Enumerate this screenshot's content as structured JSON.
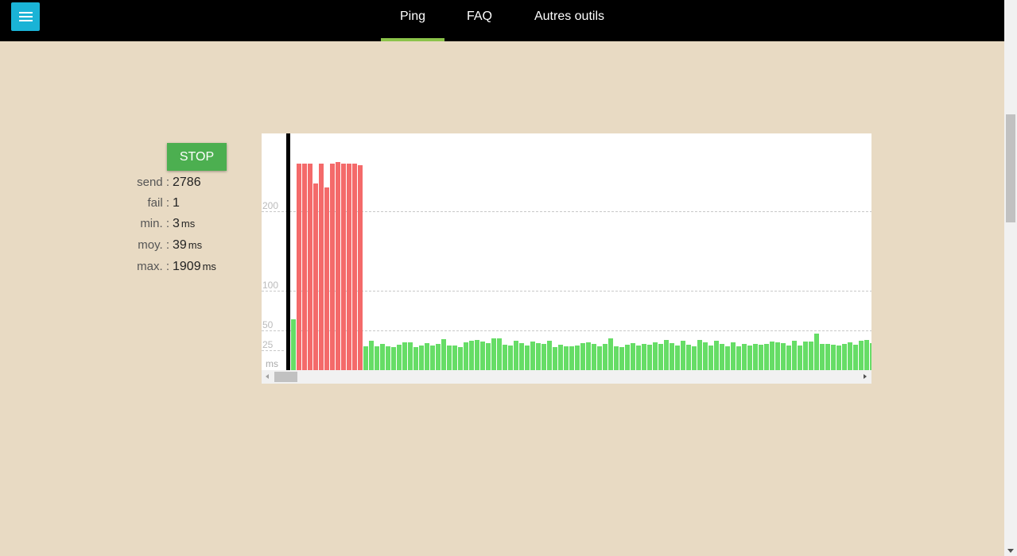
{
  "nav": {
    "tabs": [
      {
        "label": "Ping",
        "active": true
      },
      {
        "label": "FAQ",
        "active": false
      },
      {
        "label": "Autres outils",
        "active": false
      }
    ],
    "menu_icon": "hamburger-menu-icon"
  },
  "controls": {
    "stop_label": "STOP"
  },
  "stats": [
    {
      "label": "send :",
      "value": "2786",
      "unit": ""
    },
    {
      "label": "fail :",
      "value": "1",
      "unit": ""
    },
    {
      "label": "min. :",
      "value": "3",
      "unit": "ms"
    },
    {
      "label": "moy. :",
      "value": "39",
      "unit": "ms"
    },
    {
      "label": "max. :",
      "value": "1909",
      "unit": "ms"
    }
  ],
  "colors": {
    "ok": "#66dd66",
    "slow": "#f46a6a",
    "accent": "#8bc34a",
    "stop": "#4caf50",
    "menu": "#1ab3d6"
  },
  "chart_data": {
    "type": "bar",
    "ylabel": "ms",
    "y_ticks": [
      "200",
      "100",
      "50",
      "25"
    ],
    "ylim": [
      0,
      300
    ],
    "threshold_ms": 100,
    "values": [
      64,
      260,
      260,
      260,
      235,
      260,
      230,
      260,
      262,
      260,
      260,
      260,
      258,
      30,
      37,
      30,
      33,
      30,
      29,
      32,
      35,
      35,
      29,
      31,
      34,
      31,
      33,
      39,
      31,
      31,
      29,
      35,
      37,
      38,
      36,
      34,
      40,
      40,
      32,
      31,
      37,
      34,
      31,
      36,
      34,
      33,
      37,
      29,
      32,
      30,
      30,
      31,
      34,
      35,
      33,
      30,
      33,
      40,
      30,
      29,
      32,
      34,
      31,
      33,
      32,
      35,
      33,
      38,
      34,
      31,
      37,
      32,
      30,
      38,
      35,
      31,
      37,
      33,
      30,
      35,
      30,
      33,
      31,
      33,
      32,
      33,
      36,
      35,
      34,
      31,
      37,
      31,
      36,
      36,
      46,
      33,
      33,
      32,
      31,
      33,
      35,
      32,
      37,
      38,
      34,
      37,
      31,
      38
    ]
  }
}
